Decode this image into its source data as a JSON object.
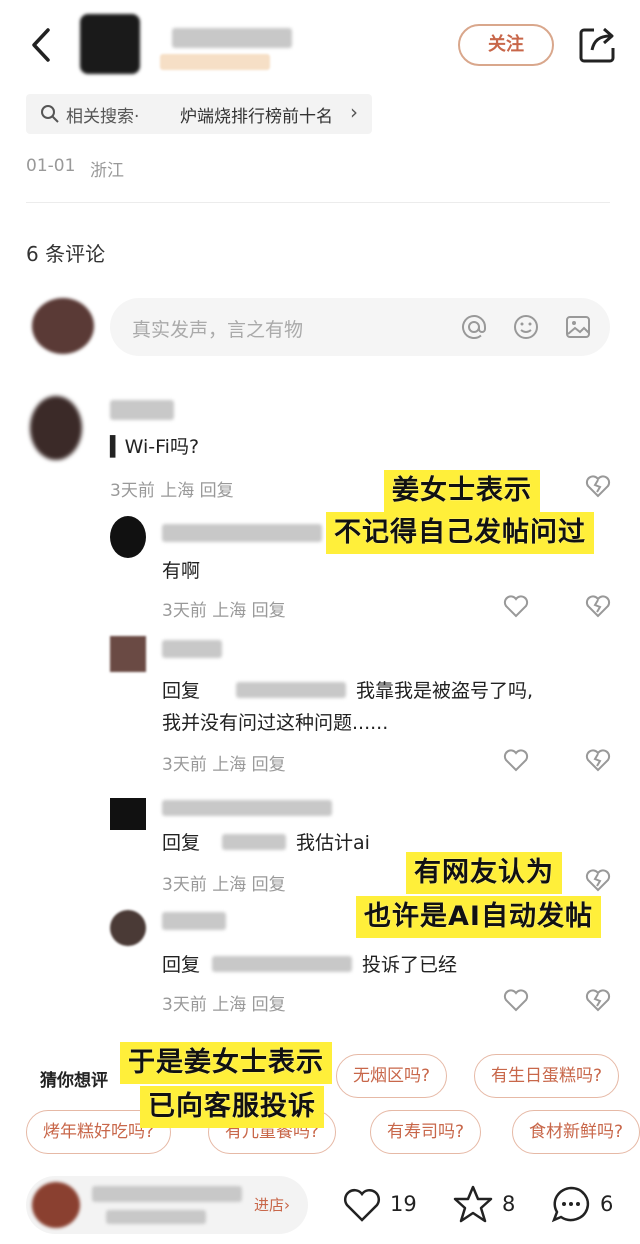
{
  "header": {
    "back_icon": "chevron-left-icon",
    "follow_label": "关注",
    "share_icon": "share-icon"
  },
  "related_search": {
    "prefix": "相关搜索·",
    "query": "炉端烧排行榜前十名",
    "arrow": "›"
  },
  "post_meta": {
    "date": "01-01",
    "location": "浙江"
  },
  "comments_count_label": "6 条评论",
  "comment_input": {
    "placeholder": "真实发声，言之有物"
  },
  "comments": [
    {
      "text": "Wi-Fi吗?",
      "meta": "3天前 上海 回复"
    },
    {
      "text": "有啊",
      "meta": "3天前 上海 回复"
    },
    {
      "text_a": "回复",
      "text_b": "我靠我是被盗号了吗,",
      "text_c": "我并没有问过这种问题......",
      "meta": "3天前 上海 回复"
    },
    {
      "text_a": "回复",
      "text_b": "我估计ai",
      "meta": "3天前 上海 回复"
    },
    {
      "text_a": "回复",
      "text_b": "投诉了已经",
      "meta": "3天前 上海 回复"
    }
  ],
  "captions": {
    "c1_line1": "姜女士表示",
    "c1_line2": "不记得自己发帖问过",
    "c2_line1": "有网友认为",
    "c2_line2": "也许是AI自动发帖",
    "c3_line1": "于是姜女士表示",
    "c3_line2": "已向客服投诉"
  },
  "guess": {
    "label": "猜你想评",
    "chips_row1": [
      "无烟区吗?",
      "有生日蛋糕吗?"
    ],
    "chips_row2": [
      "烤年糕好吃吗?",
      "有儿童餐吗?",
      "有寿司吗?",
      "食材新鲜吗?"
    ]
  },
  "bottom_bar": {
    "store_label": "进店",
    "like_count": "19",
    "star_count": "8",
    "comment_count": "6"
  },
  "colors": {
    "accent": "#c8674a",
    "caption_bg": "#ffef3a"
  }
}
